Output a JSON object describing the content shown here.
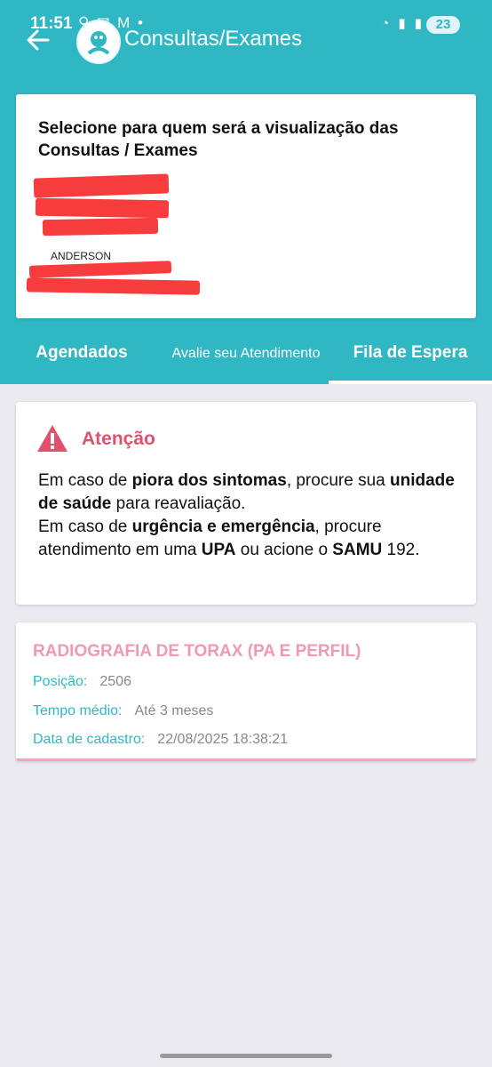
{
  "status_bar": {
    "time": "11:51",
    "left_icons": "⚲ ✉ M •",
    "right_icons": "◔ ▮ ▮",
    "battery": "23"
  },
  "header": {
    "title": "Consultas/Exames"
  },
  "patient_select": {
    "title": "Selecione para quem será a visualização das Consultas / Exames",
    "patient_name": "ANDERSON"
  },
  "tabs": [
    {
      "label": "Agendados",
      "active": false
    },
    {
      "label": "Avalie seu Atendimento",
      "active": false
    },
    {
      "label": "Fila de Espera",
      "active": true
    }
  ],
  "warning": {
    "title": "Atenção",
    "line1_a": "Em caso de ",
    "line1_b": "piora dos sintomas",
    "line1_c": ", procure sua ",
    "line1_d": "unidade de saúde",
    "line1_e": " para reavaliação.",
    "line2_a": "Em caso de ",
    "line2_b": "urgência e emergência",
    "line2_c": ", procure atendimento em uma ",
    "line2_d": "UPA",
    "line2_e": " ou acione o ",
    "line2_f": "SAMU",
    "line2_g": " 192."
  },
  "queue_item": {
    "title": "RADIOGRAFIA DE TORAX (PA E PERFIL)",
    "position_label": "Posição:",
    "position_value": "2506",
    "avg_time_label": "Tempo médio:",
    "avg_time_value": "Até 3 meses",
    "registered_label": "Data de cadastro:",
    "registered_value": "22/08/2025 18:38:21"
  },
  "colors": {
    "primary": "#2fb7c4",
    "warning": "#e0516e",
    "exam_title": "#f09ab0",
    "background": "#ebebef"
  }
}
